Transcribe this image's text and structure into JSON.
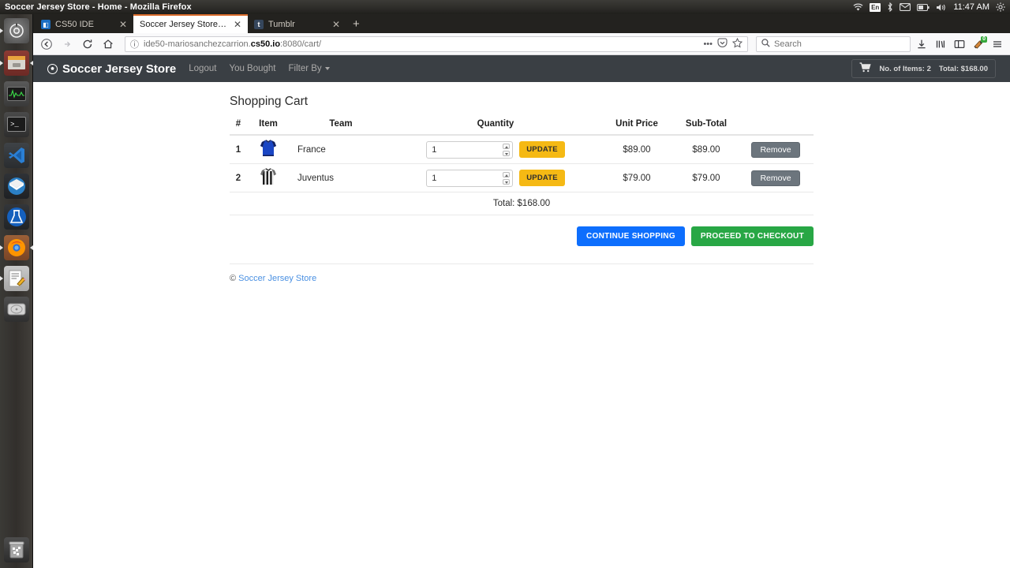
{
  "desktop": {
    "window_title": "Soccer Jersey Store - Home - Mozilla Firefox",
    "clock": "11:47 AM",
    "keyboard_layout": "En",
    "launcher": [
      {
        "name": "ubuntu-dash-icon",
        "label": "Ubuntu Dash"
      },
      {
        "name": "files-icon",
        "label": "Files"
      },
      {
        "name": "system-monitor-icon",
        "label": "System Monitor"
      },
      {
        "name": "terminal-icon",
        "label": "Terminal"
      },
      {
        "name": "vscode-icon",
        "label": "Visual Studio Code"
      },
      {
        "name": "thunderbird-icon",
        "label": "Thunderbird Mail"
      },
      {
        "name": "flask-app-icon",
        "label": "Flask"
      },
      {
        "name": "firefox-icon",
        "label": "Firefox"
      },
      {
        "name": "text-editor-icon",
        "label": "Text Editor"
      },
      {
        "name": "disk-utility-icon",
        "label": "Disks"
      },
      {
        "name": "trash-icon",
        "label": "Trash"
      }
    ]
  },
  "browser": {
    "tabs": [
      {
        "title": "CS50 IDE",
        "active": false,
        "favicon": "cs50-favicon"
      },
      {
        "title": "Soccer Jersey Store - Home",
        "active": true,
        "favicon": "none"
      },
      {
        "title": "Tumblr",
        "active": false,
        "favicon": "tumblr-favicon"
      }
    ],
    "new_tab_label": "+",
    "url_prefix": "ide50-mariosanchezcarrion.",
    "url_host": "cs50.io",
    "url_suffix": ":8080/cart/",
    "search_placeholder": "Search",
    "extension_badge": "0"
  },
  "site_nav": {
    "brand": "Soccer Jersey Store",
    "links": [
      {
        "label": "Logout",
        "dropdown": false
      },
      {
        "label": "You Bought",
        "dropdown": false
      },
      {
        "label": "Filter By",
        "dropdown": true
      }
    ],
    "cart_items_label": "No. of Items: 2",
    "cart_total_label": "Total: $168.00"
  },
  "cart": {
    "title": "Shopping Cart",
    "columns": [
      "#",
      "Item",
      "Team",
      "Quantity",
      "Unit Price",
      "Sub-Total",
      ""
    ],
    "rows": [
      {
        "num": "1",
        "team": "France",
        "jersey": "france-jersey-thumbnail",
        "quantity": "1",
        "unit_price": "$89.00",
        "sub_total": "$89.00",
        "update_label": "UPDATE",
        "remove_label": "Remove"
      },
      {
        "num": "2",
        "team": "Juventus",
        "jersey": "juventus-jersey-thumbnail",
        "quantity": "1",
        "unit_price": "$79.00",
        "sub_total": "$79.00",
        "update_label": "UPDATE",
        "remove_label": "Remove"
      }
    ],
    "total_label": "Total: $168.00",
    "continue_shopping_label": "CONTINUE SHOPPING",
    "checkout_label": "PROCEED TO CHECKOUT"
  },
  "footer": {
    "copyright_symbol": "©",
    "link_label": "Soccer Jersey Store"
  },
  "colors": {
    "navbar": "#3a3f44",
    "update_yellow": "#f5b914",
    "remove_gray": "#6c757d",
    "continue_blue": "#0d6efd",
    "checkout_green": "#28a745",
    "link_blue": "#4a90e2"
  }
}
